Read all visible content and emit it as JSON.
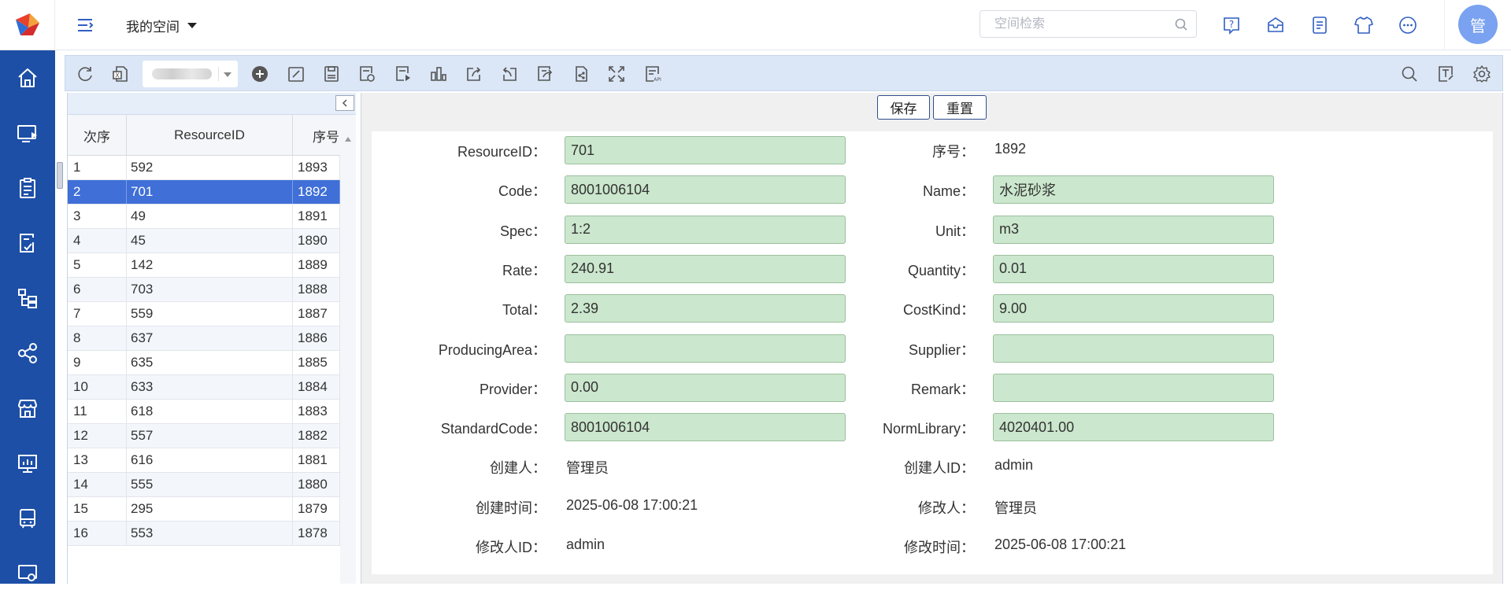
{
  "header": {
    "space_label": "我的空间",
    "search_placeholder": "空间检索",
    "avatar_text": "管",
    "icons": [
      "help-icon",
      "message-icon",
      "notes-icon",
      "theme-icon",
      "more-icon"
    ]
  },
  "leftnav": {
    "items": [
      "home-icon",
      "monitor-play-icon",
      "clipboard-icon",
      "edit-doc-icon",
      "tree-icon",
      "share-icon",
      "store-icon",
      "presentation-icon",
      "device-icon",
      "screen-settings-icon"
    ]
  },
  "toolbar": {
    "left_icons": [
      "refresh-icon",
      "export-excel-icon"
    ],
    "right_of_select_icons": [
      "add-icon",
      "edit-icon",
      "save-icon",
      "settings-doc-icon",
      "run-doc-icon",
      "chart-icon",
      "share-out-icon",
      "undo-share-icon",
      "edit-share-icon",
      "publish-icon",
      "fullscreen-icon",
      "api-icon"
    ],
    "far_right_icons": [
      "search-icon",
      "text-format-icon",
      "gear-icon"
    ]
  },
  "grid": {
    "columns": [
      "次序",
      "ResourceID",
      "序号"
    ],
    "rows": [
      [
        "1",
        "592",
        "1893"
      ],
      [
        "2",
        "701",
        "1892"
      ],
      [
        "3",
        "49",
        "1891"
      ],
      [
        "4",
        "45",
        "1890"
      ],
      [
        "5",
        "142",
        "1889"
      ],
      [
        "6",
        "703",
        "1888"
      ],
      [
        "7",
        "559",
        "1887"
      ],
      [
        "8",
        "637",
        "1886"
      ],
      [
        "9",
        "635",
        "1885"
      ],
      [
        "10",
        "633",
        "1884"
      ],
      [
        "11",
        "618",
        "1883"
      ],
      [
        "12",
        "557",
        "1882"
      ],
      [
        "13",
        "616",
        "1881"
      ],
      [
        "14",
        "555",
        "1880"
      ],
      [
        "15",
        "295",
        "1879"
      ],
      [
        "16",
        "553",
        "1878"
      ]
    ],
    "selected_index": 1
  },
  "form": {
    "save_label": "保存",
    "reset_label": "重置",
    "left": [
      {
        "label": "ResourceID：",
        "value": "701",
        "type": "input"
      },
      {
        "label": "Code：",
        "value": "8001006104",
        "type": "input"
      },
      {
        "label": "Spec：",
        "value": "1:2",
        "type": "input"
      },
      {
        "label": "Rate：",
        "value": "240.91",
        "type": "input"
      },
      {
        "label": "Total：",
        "value": "2.39",
        "type": "input"
      },
      {
        "label": "ProducingArea：",
        "value": "",
        "type": "input"
      },
      {
        "label": "Provider：",
        "value": "0.00",
        "type": "input"
      },
      {
        "label": "StandardCode：",
        "value": "8001006104",
        "type": "input"
      },
      {
        "label": "创建人：",
        "value": "管理员",
        "type": "text"
      },
      {
        "label": "创建时间：",
        "value": "2025-06-08 17:00:21",
        "type": "text"
      },
      {
        "label": "修改人ID：",
        "value": "admin",
        "type": "text"
      }
    ],
    "right": [
      {
        "label": "序号：",
        "value": "1892",
        "type": "text"
      },
      {
        "label": "Name：",
        "value": "水泥砂浆",
        "type": "input"
      },
      {
        "label": "Unit：",
        "value": "m3",
        "type": "input"
      },
      {
        "label": "Quantity：",
        "value": "0.01",
        "type": "input"
      },
      {
        "label": "CostKind：",
        "value": "9.00",
        "type": "input"
      },
      {
        "label": "Supplier：",
        "value": "",
        "type": "input"
      },
      {
        "label": "Remark：",
        "value": "",
        "type": "input"
      },
      {
        "label": "NormLibrary：",
        "value": "4020401.00",
        "type": "input"
      },
      {
        "label": "创建人ID：",
        "value": "admin",
        "type": "text"
      },
      {
        "label": "修改人：",
        "value": "管理员",
        "type": "text"
      },
      {
        "label": "修改时间：",
        "value": "2025-06-08 17:00:21",
        "type": "text"
      }
    ]
  }
}
